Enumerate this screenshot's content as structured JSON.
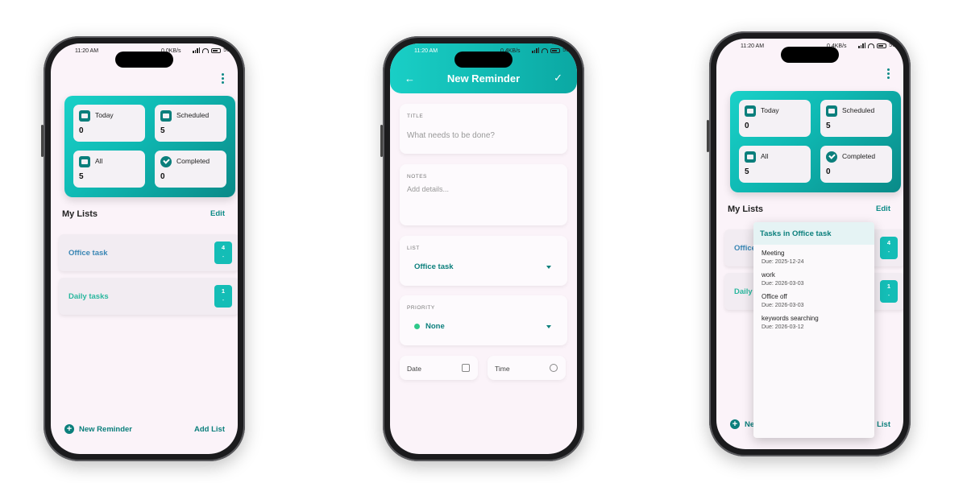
{
  "status": {
    "time": "11:20 AM",
    "net1": "0.0KB/s",
    "net2": "0.4KB/s",
    "battery": "56"
  },
  "home": {
    "cards": [
      {
        "label": "Today",
        "count": "0",
        "icon": "calendar-today-icon"
      },
      {
        "label": "Scheduled",
        "count": "5",
        "icon": "calendar-grid-icon"
      },
      {
        "label": "All",
        "count": "5",
        "icon": "inbox-icon"
      },
      {
        "label": "Completed",
        "count": "0",
        "icon": "check-circle-icon"
      }
    ],
    "my_lists_title": "My Lists",
    "edit_label": "Edit",
    "lists": [
      {
        "name": "Office task",
        "count": "4",
        "sub": "-",
        "color": "#3a86b4"
      },
      {
        "name": "Daily tasks",
        "count": "1",
        "sub": "-",
        "color": "#2ab79e"
      }
    ],
    "new_reminder_label": "New Reminder",
    "add_list_label": "Add List"
  },
  "form": {
    "header_title": "New Reminder",
    "title_caption": "TITLE",
    "title_placeholder": "What needs to be done?",
    "notes_caption": "NOTES",
    "notes_placeholder": "Add details...",
    "list_caption": "LIST",
    "list_value": "Office task",
    "priority_caption": "PRIORITY",
    "priority_value": "None",
    "date_label": "Date",
    "time_label": "Time"
  },
  "popup": {
    "title": "Tasks in Office task",
    "items": [
      {
        "name": "Meeting",
        "due": "Due: 2025-12-24"
      },
      {
        "name": "work",
        "due": "Due: 2026-03-03"
      },
      {
        "name": "Office off",
        "due": "Due: 2026-03-03"
      },
      {
        "name": "keywords searching",
        "due": "Due: 2026-03-12"
      }
    ],
    "new_partial": "Ne",
    "add_partial": "d List",
    "office_partial": "Office t",
    "daily_partial": "Daily ta"
  },
  "colors": {
    "accent": "#0b7f7c",
    "teal": "#14bdb6",
    "background": "#fbf3f9"
  }
}
